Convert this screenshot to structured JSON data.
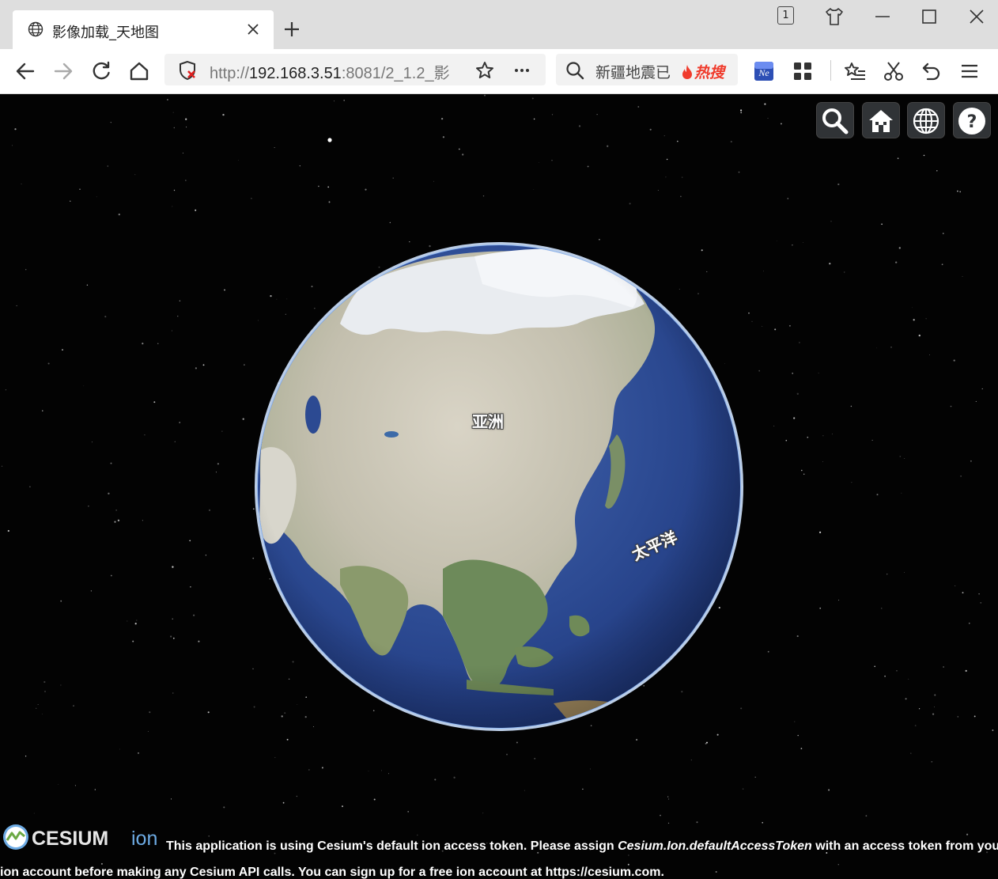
{
  "browser": {
    "tab_title": "影像加载_天地图",
    "tab_count": "1",
    "url_scheme": "http://",
    "url_host": "192.168.3.51",
    "url_rest": ":8081/2_1.2_影",
    "search_query": "新疆地震已",
    "search_hot_label": "热搜",
    "icons": {
      "favicon": "globe-icon",
      "close": "close-icon",
      "new_tab": "plus-icon",
      "back": "back-arrow-icon",
      "forward": "forward-arrow-icon",
      "reload": "reload-icon",
      "home": "home-icon",
      "security": "shield-x-icon",
      "bookmark": "star-icon",
      "more": "more-icon",
      "search": "search-icon",
      "extension": "ne-extension-icon",
      "apps": "apps-grid-icon",
      "favorites": "favorites-list-icon",
      "screenshot": "scissors-icon",
      "undo": "undo-icon",
      "menu": "menu-icon",
      "skin": "tshirt-icon",
      "minimize": "minimize-icon",
      "maximize": "maximize-icon",
      "window_close": "window-close-icon"
    }
  },
  "viewer": {
    "toolbar_buttons": [
      "search-button",
      "home-button",
      "scene-mode-button",
      "help-button"
    ],
    "labels": {
      "asia": "亚洲",
      "pacific": "太平洋"
    },
    "credit": {
      "logo_text": "CESIUM",
      "logo_suffix": "ion",
      "line1_a": "This application is using Cesium's default ion access token. Please assign ",
      "line1_b": "Cesium.Ion.defaultAccessToken",
      "line1_c": " with an access token from your",
      "line2": "ion account before making any Cesium API calls. You can sign up for a free ion account at https://cesium.com."
    },
    "colors": {
      "space": "#030303",
      "ocean": "#2c4a92",
      "button_bg": "#303336",
      "atmosphere": "#b9d6ff"
    }
  }
}
